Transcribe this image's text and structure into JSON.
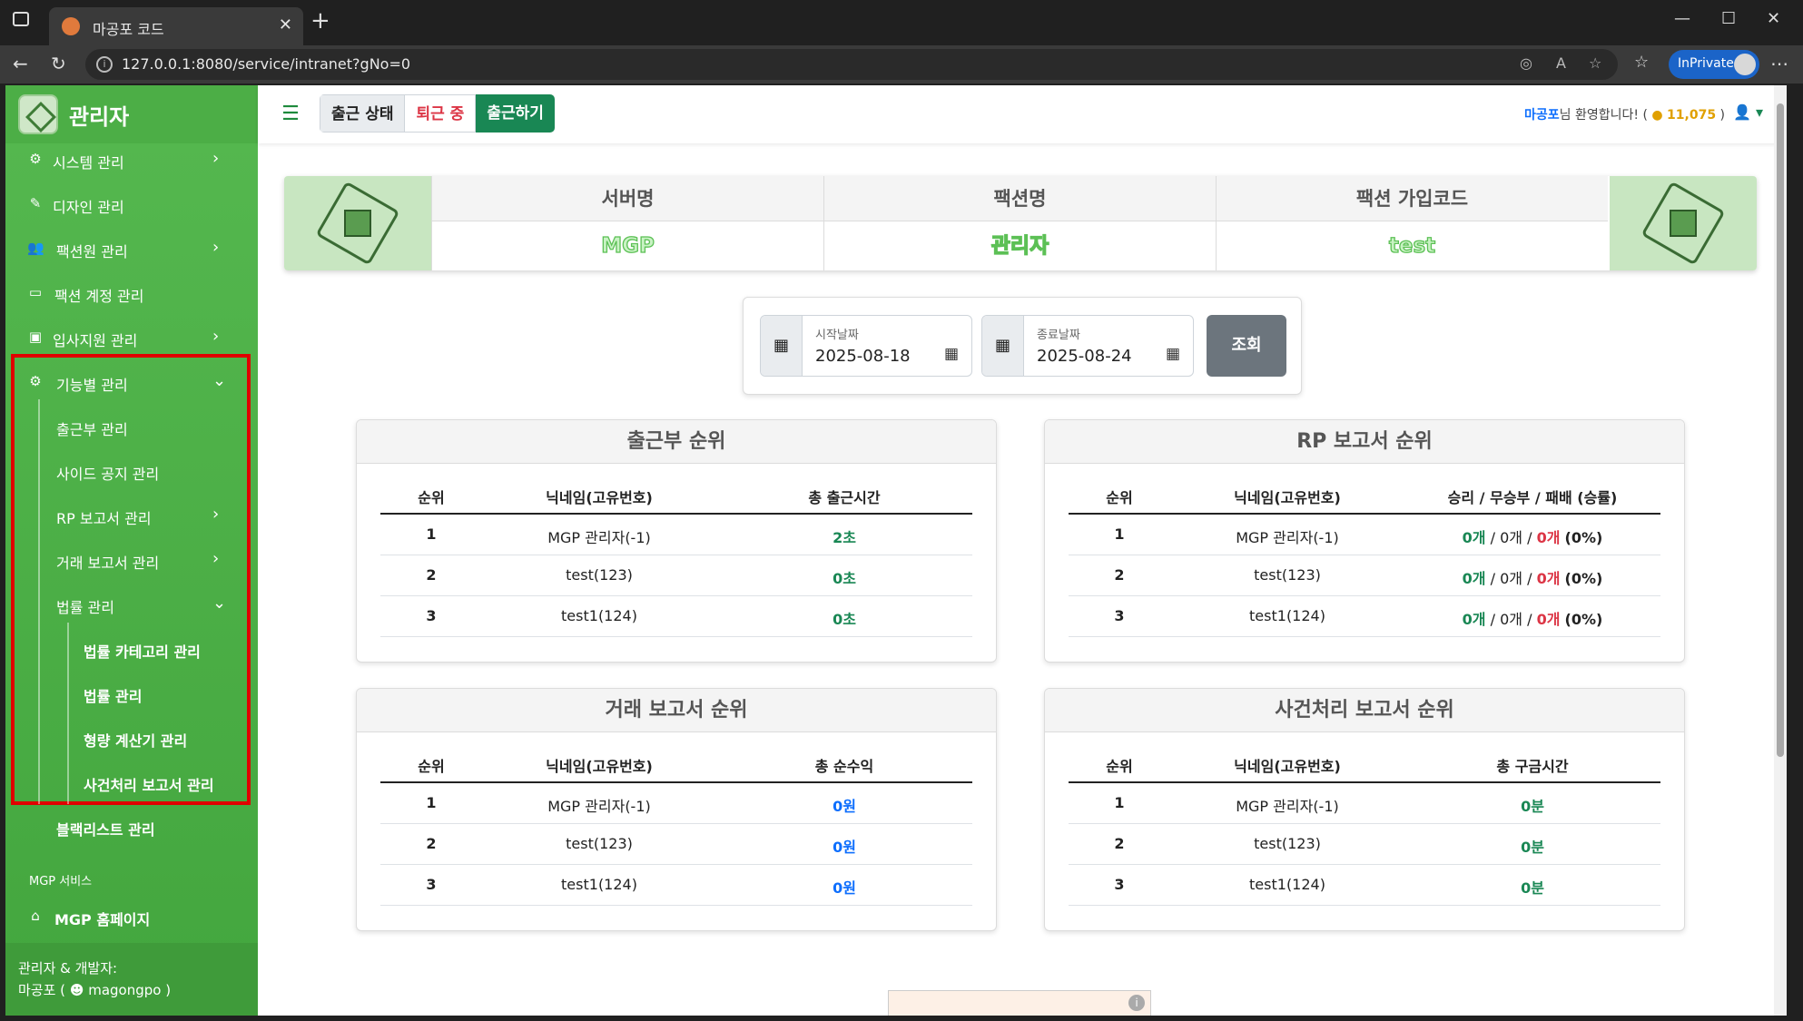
{
  "browser": {
    "tab_title": "마공포 코드",
    "url": "127.0.0.1:8080/service/intranet?gNo=0",
    "inprivate_label": "InPrivate"
  },
  "sidebar": {
    "brand": "관리자",
    "items": [
      {
        "label": "시스템 관리",
        "icon": "gear-icon"
      },
      {
        "label": "디자인 관리",
        "icon": "brush-icon"
      },
      {
        "label": "팩션원 관리",
        "icon": "users-icon"
      },
      {
        "label": "팩션 계정 관리",
        "icon": "id-card-icon"
      },
      {
        "label": "입사지원 관리",
        "icon": "briefcase-icon"
      },
      {
        "label": "기능별 관리",
        "icon": "gears-icon"
      },
      {
        "label": "출근부 관리"
      },
      {
        "label": "사이드 공지 관리"
      },
      {
        "label": "RP 보고서 관리"
      },
      {
        "label": "거래 보고서 관리"
      },
      {
        "label": "법률 관리"
      },
      {
        "label": "법률 카테고리 관리"
      },
      {
        "label": "법률 관리"
      },
      {
        "label": "형량 계산기 관리"
      },
      {
        "label": "사건처리 보고서 관리"
      },
      {
        "label": "블랙리스트 관리"
      }
    ],
    "section_title": "MGP 서비스",
    "home_label": "MGP 홈페이지",
    "footer_line1": "관리자 & 개발자:",
    "footer_line2": "마공포 (",
    "footer_discord": "magongpo )"
  },
  "topnav": {
    "attendance_label": "출근 상태",
    "attendance_status": "퇴근 중",
    "attendance_button": "출근하기",
    "welcome_name": "마공포",
    "welcome_text": "님 환영합니다! (",
    "points": "11,075",
    "welcome_close": " )"
  },
  "server_info": {
    "headers": [
      "서버명",
      "팩션명",
      "팩션 가입코드"
    ],
    "values": [
      "MGP",
      "관리자",
      "test"
    ]
  },
  "search": {
    "start_label": "시작날짜",
    "start_date": "2025-08-18",
    "end_label": "종료날짜",
    "end_date": "2025-08-24",
    "button": "조회"
  },
  "rankings": {
    "attendance": {
      "title": "출근부 순위",
      "columns": [
        "순위",
        "닉네임(고유번호)",
        "총 출근시간"
      ],
      "rows": [
        {
          "rank": "1",
          "name": "MGP 관리자(-1)",
          "value": "2초"
        },
        {
          "rank": "2",
          "name": "test(123)",
          "value": "0초"
        },
        {
          "rank": "3",
          "name": "test1(124)",
          "value": "0초"
        }
      ]
    },
    "rp": {
      "title": "RP 보고서 순위",
      "columns": [
        "순위",
        "닉네임(고유번호)",
        "승리 / 무승부 / 패배 (승률)"
      ],
      "rows": [
        {
          "rank": "1",
          "name": "MGP 관리자(-1)",
          "win": "0개",
          "draw": "0개",
          "loss": "0개",
          "rate": "(0%)"
        },
        {
          "rank": "2",
          "name": "test(123)",
          "win": "0개",
          "draw": "0개",
          "loss": "0개",
          "rate": "(0%)"
        },
        {
          "rank": "3",
          "name": "test1(124)",
          "win": "0개",
          "draw": "0개",
          "loss": "0개",
          "rate": "(0%)"
        }
      ]
    },
    "trade": {
      "title": "거래 보고서 순위",
      "columns": [
        "순위",
        "닉네임(고유번호)",
        "총 순수익"
      ],
      "rows": [
        {
          "rank": "1",
          "name": "MGP 관리자(-1)",
          "value": "0원"
        },
        {
          "rank": "2",
          "name": "test(123)",
          "value": "0원"
        },
        {
          "rank": "3",
          "name": "test1(124)",
          "value": "0원"
        }
      ]
    },
    "incident": {
      "title": "사건처리 보고서 순위",
      "columns": [
        "순위",
        "닉네임(고유번호)",
        "총 구금시간"
      ],
      "rows": [
        {
          "rank": "1",
          "name": "MGP 관리자(-1)",
          "value": "0분"
        },
        {
          "rank": "2",
          "name": "test(123)",
          "value": "0분"
        },
        {
          "rank": "3",
          "name": "test1(124)",
          "value": "0분"
        }
      ]
    }
  },
  "colors": {
    "sidebar_green": "#4cae46",
    "success": "#198754",
    "danger": "#dc3545",
    "primary": "#0d6efd",
    "highlight_box": "#e00000"
  }
}
